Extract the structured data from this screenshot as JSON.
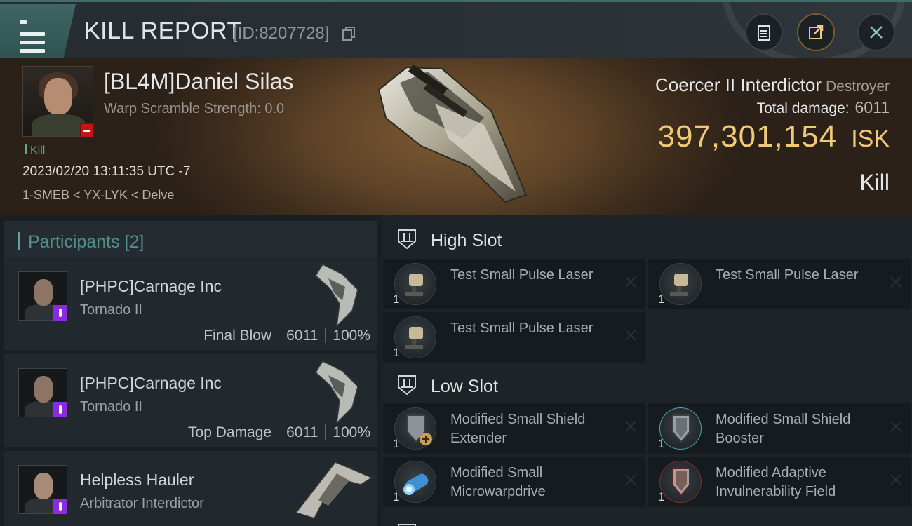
{
  "header": {
    "title": "KILL REPORT",
    "id_text": "[ID:8207728]"
  },
  "victim": {
    "name": "[BL4M]Daniel Silas",
    "warp_scramble": "Warp Scramble Strength: 0.0",
    "tag": "Kill",
    "datetime": "2023/02/20 13:11:35 UTC -7",
    "location": "1-SMEB < YX-LYK < Delve",
    "ship_name": "Coercer II Interdictor",
    "ship_class": "Destroyer",
    "total_damage_label": "Total damage:",
    "total_damage": "6011",
    "isk_value": "397,301,154",
    "isk_unit": "ISK",
    "result": "Kill"
  },
  "participants": {
    "title": "Participants [2]",
    "items": [
      {
        "name": "[PHPC]Carnage Inc",
        "ship": "Tornado II",
        "role": "Final Blow",
        "damage": "6011",
        "percent": "100%"
      },
      {
        "name": "[PHPC]Carnage Inc",
        "ship": "Tornado II",
        "role": "Top Damage",
        "damage": "6011",
        "percent": "100%"
      },
      {
        "name": "Helpless Hauler",
        "ship": "Arbitrator Interdictor"
      }
    ]
  },
  "fittings": {
    "high_slot": {
      "title": "High Slot",
      "modules": [
        {
          "name": "Test Small Pulse Laser",
          "qty": "1",
          "icon": "laser-icon"
        },
        {
          "name": "Test Small Pulse Laser",
          "qty": "1",
          "icon": "laser-icon"
        },
        {
          "name": "Test Small Pulse Laser",
          "qty": "1",
          "icon": "laser-icon"
        }
      ]
    },
    "low_slot": {
      "title": "Low Slot",
      "modules": [
        {
          "name": "Modified Small Shield Extender",
          "qty": "1",
          "icon": "shield-extender-icon"
        },
        {
          "name": "Modified Small Shield Booster",
          "qty": "1",
          "icon": "shield-booster-icon"
        },
        {
          "name": "Modified Small Microwarpdrive",
          "qty": "1",
          "icon": "microwarpdrive-icon"
        },
        {
          "name": "Modified Adaptive Invulnerability Field",
          "qty": "1",
          "icon": "invulnerability-field-icon"
        }
      ]
    }
  },
  "colors": {
    "accent": "#5ea69d",
    "isk": "#f0c977",
    "kill_badge": "#c01818",
    "participant_badge": "#8a2be2"
  }
}
